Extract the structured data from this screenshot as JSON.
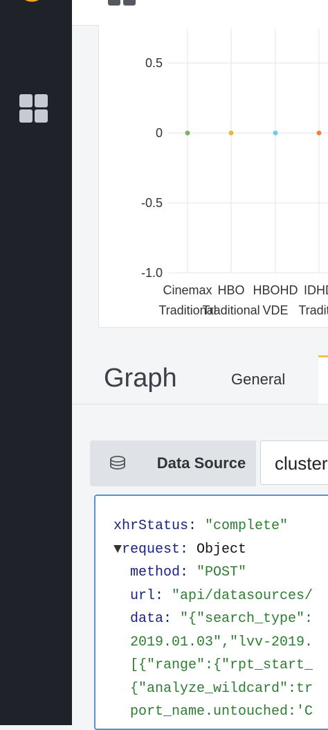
{
  "chart_data": {
    "type": "scatter",
    "y_ticks": [
      "0.5",
      "0",
      "-0.5",
      "-1.0"
    ],
    "categories": [
      {
        "line1": "Cinemax",
        "line2": "Traditional"
      },
      {
        "line1": "HBO",
        "line2": "Traditional"
      },
      {
        "line1": "HBOHD",
        "line2": "VDE"
      },
      {
        "line1": "IDHD",
        "line2": "Traditio"
      }
    ],
    "values": [
      0,
      0,
      0,
      0
    ],
    "point_colors": [
      "#7eb26d",
      "#eab839",
      "#6ed0e0",
      "#ef843c"
    ],
    "ylim": [
      -1.0,
      0.5
    ],
    "grid": true
  },
  "tabs": {
    "title": "Graph",
    "general": "General"
  },
  "data_source": {
    "label": "Data Source",
    "value": "cluster"
  },
  "inspector": {
    "lines": [
      {
        "indent": 0,
        "key": "xhrStatus",
        "value": "\"complete\"",
        "type": "str"
      },
      {
        "indent": 0,
        "toggle": "▼",
        "key": "request",
        "value": "Object",
        "type": "plain"
      },
      {
        "indent": 1,
        "key": "method",
        "value": "\"POST\"",
        "type": "str"
      },
      {
        "indent": 1,
        "key": "url",
        "value": "\"api/datasources/",
        "type": "str"
      },
      {
        "indent": 1,
        "key": "data",
        "value": "\"{\"search_type\":",
        "type": "str"
      },
      {
        "indent": 1,
        "text": "2019.01.03\",\"lvv-2019.",
        "type": "str"
      },
      {
        "indent": 1,
        "text": "[{\"range\":{\"rpt_start_",
        "type": "str"
      },
      {
        "indent": 1,
        "text": "{\"analyze_wildcard\":tr",
        "type": "str"
      },
      {
        "indent": 1,
        "text": "port_name.untouched:'C",
        "type": "str"
      }
    ]
  }
}
